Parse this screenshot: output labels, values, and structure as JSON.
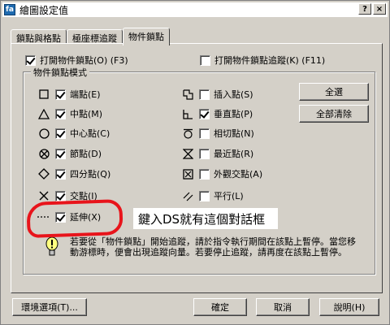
{
  "window": {
    "title": "繪圖設定值",
    "icon_text": "fa",
    "help_btn": "?",
    "close_btn": "×"
  },
  "tabs": [
    "鎖點與格點",
    "極座標追蹤",
    "物件鎖點"
  ],
  "osnap_on": {
    "label": "打開物件鎖點(O) (F3)",
    "checked": true
  },
  "osnap_track": {
    "label": "打開物件鎖點追蹤(K) (F11)",
    "checked": false
  },
  "group_title": "物件鎖點模式",
  "left_modes": [
    {
      "label": "端點(E)",
      "checked": true,
      "icon": "square-icon"
    },
    {
      "label": "中點(M)",
      "checked": true,
      "icon": "triangle-icon"
    },
    {
      "label": "中心點(C)",
      "checked": true,
      "icon": "circle-icon"
    },
    {
      "label": "節點(D)",
      "checked": true,
      "icon": "circle-x-icon"
    },
    {
      "label": "四分點(Q)",
      "checked": true,
      "icon": "diamond-icon"
    },
    {
      "label": "交點(I)",
      "checked": true,
      "icon": "x-icon"
    },
    {
      "label": "延伸(X)",
      "checked": true,
      "icon": "dotted-line-icon"
    }
  ],
  "right_modes": [
    {
      "label": "插入點(S)",
      "checked": false,
      "icon": "insert-icon"
    },
    {
      "label": "垂直點(P)",
      "checked": true,
      "icon": "perpendicular-icon"
    },
    {
      "label": "相切點(N)",
      "checked": false,
      "icon": "tangent-icon"
    },
    {
      "label": "最近點(R)",
      "checked": false,
      "icon": "hourglass-icon"
    },
    {
      "label": "外觀交點(A)",
      "checked": false,
      "icon": "box-x-icon"
    },
    {
      "label": "平行(L)",
      "checked": false,
      "icon": "parallel-icon"
    }
  ],
  "buttons": {
    "select_all": "全選",
    "clear_all": "全部清除",
    "options": "環境選項(T)...",
    "ok": "確定",
    "cancel": "取消",
    "help": "說明(H)"
  },
  "info_text": "若要從「物件鎖點」開始追蹤，請於指令執行期間在該點上暫停。當您移動游標時，便會出現追蹤向量。若要停止追蹤，請再度在該點上暫停。",
  "callout_text": "鍵入DS就有這個對話框",
  "colors": {
    "annotation": "#e8141b",
    "dialog_bg": "#d4d0c8"
  }
}
